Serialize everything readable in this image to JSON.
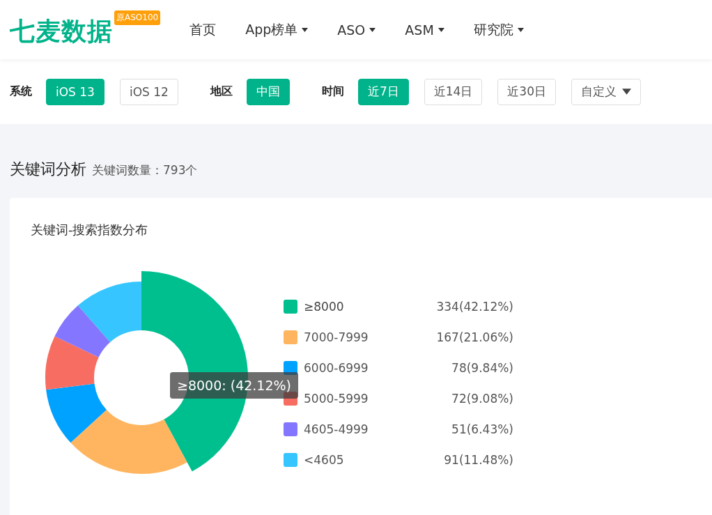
{
  "header": {
    "logo": "七麦数据",
    "logo_badge": "原ASO100",
    "nav": [
      {
        "label": "首页",
        "dropdown": false
      },
      {
        "label": "App榜单",
        "dropdown": true
      },
      {
        "label": "ASO",
        "dropdown": true
      },
      {
        "label": "ASM",
        "dropdown": true
      },
      {
        "label": "研究院",
        "dropdown": true
      }
    ]
  },
  "filters": [
    {
      "label": "系统",
      "options": [
        {
          "label": "iOS 13",
          "selected": true,
          "dropdown": false
        },
        {
          "label": "iOS 12",
          "selected": false,
          "dropdown": false
        }
      ]
    },
    {
      "label": "地区",
      "options": [
        {
          "label": "中国",
          "selected": true,
          "dropdown": false
        }
      ]
    },
    {
      "label": "时间",
      "options": [
        {
          "label": "近7日",
          "selected": true,
          "dropdown": false
        },
        {
          "label": "近14日",
          "selected": false,
          "dropdown": false
        },
        {
          "label": "近30日",
          "selected": false,
          "dropdown": false
        },
        {
          "label": "自定义",
          "selected": false,
          "dropdown": true
        }
      ]
    }
  ],
  "section": {
    "title": "关键词分析",
    "subtitle": "关键词数量：793个"
  },
  "card": {
    "title": "关键词-搜索指数分布",
    "chart_data": {
      "type": "donut",
      "categories": [
        "≥8000",
        "7000-7999",
        "6000-6999",
        "5000-5999",
        "4605-4999",
        "<4605"
      ],
      "values": [
        42.12,
        21.06,
        9.84,
        9.08,
        6.43,
        11.48
      ]
    },
    "legend": [
      {
        "reading": "334(42.12%)",
        "color": "#00bf8f",
        "highlighted": true
      },
      {
        "reading": "167(21.06%)",
        "color": "#ffb55f",
        "highlighted": false
      },
      {
        "reading": "78(9.84%)",
        "color": "#00a2ff",
        "highlighted": false
      },
      {
        "reading": "72(9.08%)",
        "color": "#f86d62",
        "highlighted": false
      },
      {
        "reading": "51(6.43%)",
        "color": "#8576ff",
        "highlighted": false
      },
      {
        "reading": "91(11.48%)",
        "color": "#36c5ff",
        "highlighted": false
      }
    ],
    "tooltip": "≥8000: (42.12%)"
  }
}
